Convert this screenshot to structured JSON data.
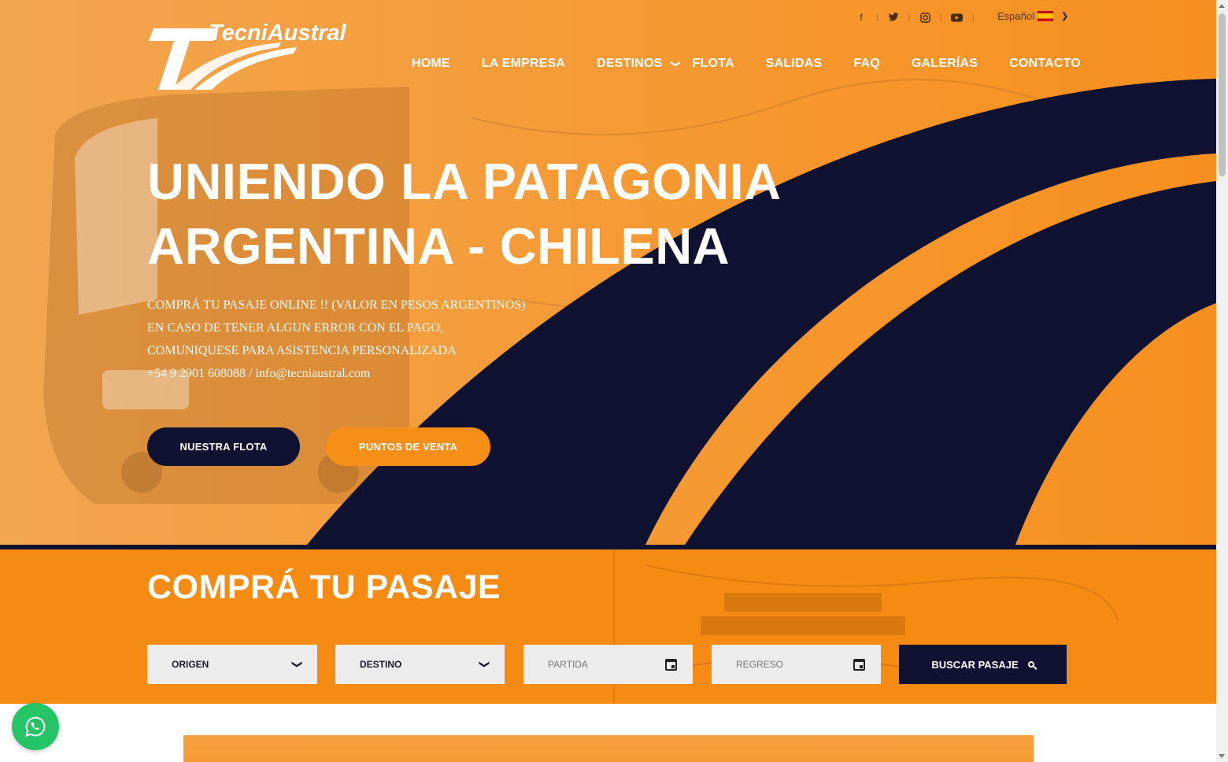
{
  "header": {
    "logo_text": "TecniAustral",
    "social": [
      {
        "icon": "facebook-icon",
        "glyph": "f"
      },
      {
        "icon": "twitter-icon",
        "glyph": "🐦"
      },
      {
        "icon": "instagram-icon",
        "glyph": "◎"
      },
      {
        "icon": "youtube-icon",
        "glyph": "▶"
      }
    ],
    "language": "Español",
    "nav": [
      "HOME",
      "LA EMPRESA",
      "DESTINOS",
      "FLOTA",
      "SALIDAS",
      "FAQ",
      "GALERÍAS",
      "CONTACTO"
    ]
  },
  "hero": {
    "title_line1": "UNIENDO LA PATAGONIA",
    "title_line2": "ARGENTINA - CHILENA",
    "sub_line1": "COMPRÁ TU PASAJE ONLINE !! (VALOR EN PESOS ARGENTINOS)",
    "sub_line2": "EN CASO DE TENER ALGUN ERROR CON EL PAGO,",
    "sub_line3": "COMUNIQUESE PARA ASISTENCIA PERSONALIZADA",
    "sub_line4": "+54 9 2901 608088 / info@tecniaustral.com",
    "btn_flota": "NUESTRA FLOTA",
    "btn_venta": "PUNTOS DE VENTA"
  },
  "search": {
    "title": "COMPRÁ TU PASAJE",
    "origen": "ORIGEN",
    "destino": "DESTINO",
    "partida": "PARTIDA",
    "regreso": "REGRESO",
    "buscar": "BUSCAR PASAJE"
  },
  "colors": {
    "orange": "#f68b14",
    "navy": "#0f1231",
    "whatsapp": "#25c466"
  }
}
